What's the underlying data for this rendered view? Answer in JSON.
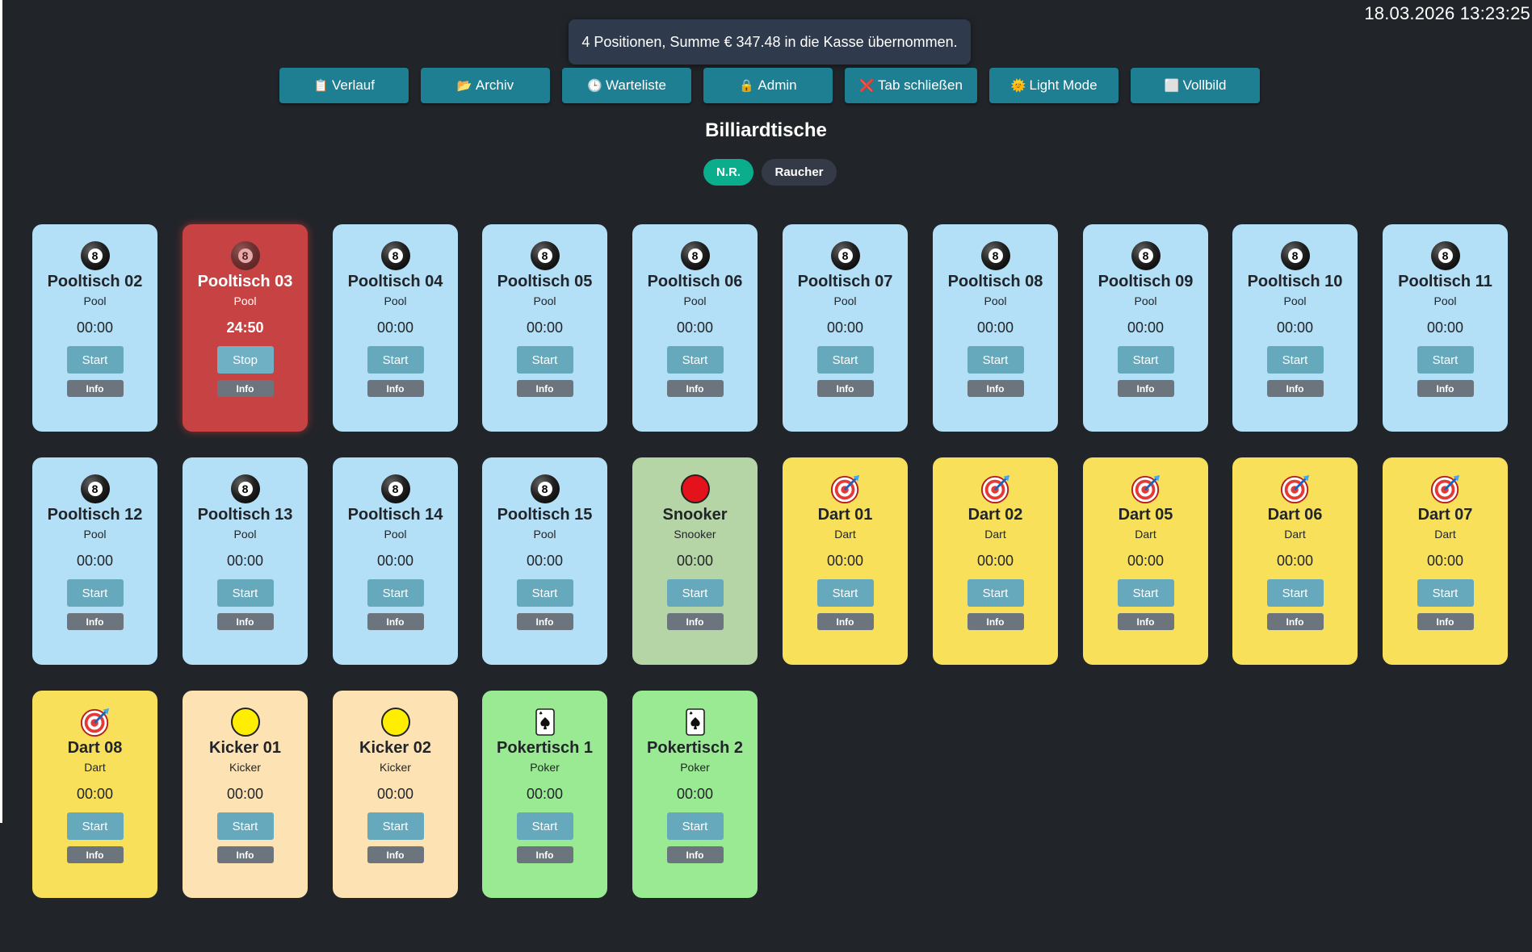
{
  "clock": "18.03.2026 13:23:25",
  "toast": "4 Positionen, Summe € 347.48 in die Kasse übernommen.",
  "toolbar": [
    {
      "icon": "clipboard-icon",
      "glyph": "📋",
      "label": "Verlauf"
    },
    {
      "icon": "folder-icon",
      "glyph": "📂",
      "label": "Archiv"
    },
    {
      "icon": "clock-icon",
      "glyph": "🕒",
      "label": "Warteliste"
    },
    {
      "icon": "lock-icon",
      "glyph": "🔒",
      "label": "Admin"
    },
    {
      "icon": "cross-icon",
      "glyph": "❌",
      "label": "Tab schließen"
    },
    {
      "icon": "sun-icon",
      "glyph": "🌞",
      "label": "Light Mode"
    },
    {
      "icon": "square-icon",
      "glyph": "⬜",
      "label": "Vollbild"
    }
  ],
  "title": "Billiardtische",
  "filters": {
    "nr": "N.R.",
    "raucher": "Raucher"
  },
  "labels": {
    "start": "Start",
    "stop": "Stop",
    "info": "Info"
  },
  "colors": {
    "background": "#212529",
    "toolbar_button": "#1e7f93",
    "pool": "#b3dff7",
    "active": "#c74343",
    "snooker": "#b6d5a6",
    "dart": "#f8e05a",
    "kicker": "#fde2b4",
    "poker": "#9aea93",
    "filter_active": "#0bae8c"
  },
  "tables": [
    {
      "name": "Pooltisch 02",
      "type": "Pool",
      "time": "00:00",
      "icon": "eight-ball-icon",
      "kind": "pool",
      "running": false
    },
    {
      "name": "Pooltisch 03",
      "type": "Pool",
      "time": "24:50",
      "icon": "eight-ball-icon",
      "kind": "pool",
      "running": true
    },
    {
      "name": "Pooltisch 04",
      "type": "Pool",
      "time": "00:00",
      "icon": "eight-ball-icon",
      "kind": "pool",
      "running": false
    },
    {
      "name": "Pooltisch 05",
      "type": "Pool",
      "time": "00:00",
      "icon": "eight-ball-icon",
      "kind": "pool",
      "running": false
    },
    {
      "name": "Pooltisch 06",
      "type": "Pool",
      "time": "00:00",
      "icon": "eight-ball-icon",
      "kind": "pool",
      "running": false
    },
    {
      "name": "Pooltisch 07",
      "type": "Pool",
      "time": "00:00",
      "icon": "eight-ball-icon",
      "kind": "pool",
      "running": false
    },
    {
      "name": "Pooltisch 08",
      "type": "Pool",
      "time": "00:00",
      "icon": "eight-ball-icon",
      "kind": "pool",
      "running": false
    },
    {
      "name": "Pooltisch 09",
      "type": "Pool",
      "time": "00:00",
      "icon": "eight-ball-icon",
      "kind": "pool",
      "running": false
    },
    {
      "name": "Pooltisch 10",
      "type": "Pool",
      "time": "00:00",
      "icon": "eight-ball-icon",
      "kind": "pool",
      "running": false
    },
    {
      "name": "Pooltisch 11",
      "type": "Pool",
      "time": "00:00",
      "icon": "eight-ball-icon",
      "kind": "pool",
      "running": false
    },
    {
      "name": "Pooltisch 12",
      "type": "Pool",
      "time": "00:00",
      "icon": "eight-ball-icon",
      "kind": "pool",
      "running": false
    },
    {
      "name": "Pooltisch 13",
      "type": "Pool",
      "time": "00:00",
      "icon": "eight-ball-icon",
      "kind": "pool",
      "running": false
    },
    {
      "name": "Pooltisch 14",
      "type": "Pool",
      "time": "00:00",
      "icon": "eight-ball-icon",
      "kind": "pool",
      "running": false
    },
    {
      "name": "Pooltisch 15",
      "type": "Pool",
      "time": "00:00",
      "icon": "eight-ball-icon",
      "kind": "pool",
      "running": false
    },
    {
      "name": "Snooker",
      "type": "Snooker",
      "time": "00:00",
      "icon": "red-ball-icon",
      "kind": "snooker",
      "running": false
    },
    {
      "name": "Dart 01",
      "type": "Dart",
      "time": "00:00",
      "icon": "dart-target-icon",
      "kind": "dart",
      "running": false
    },
    {
      "name": "Dart 02",
      "type": "Dart",
      "time": "00:00",
      "icon": "dart-target-icon",
      "kind": "dart",
      "running": false
    },
    {
      "name": "Dart 05",
      "type": "Dart",
      "time": "00:00",
      "icon": "dart-target-icon",
      "kind": "dart",
      "running": false
    },
    {
      "name": "Dart 06",
      "type": "Dart",
      "time": "00:00",
      "icon": "dart-target-icon",
      "kind": "dart",
      "running": false
    },
    {
      "name": "Dart 07",
      "type": "Dart",
      "time": "00:00",
      "icon": "dart-target-icon",
      "kind": "dart",
      "running": false
    },
    {
      "name": "Dart 08",
      "type": "Dart",
      "time": "00:00",
      "icon": "dart-target-icon",
      "kind": "dart",
      "running": false
    },
    {
      "name": "Kicker 01",
      "type": "Kicker",
      "time": "00:00",
      "icon": "yellow-ball-icon",
      "kind": "kicker",
      "running": false
    },
    {
      "name": "Kicker 02",
      "type": "Kicker",
      "time": "00:00",
      "icon": "yellow-ball-icon",
      "kind": "kicker",
      "running": false
    },
    {
      "name": "Pokertisch 1",
      "type": "Poker",
      "time": "00:00",
      "icon": "playing-card-icon",
      "kind": "poker",
      "running": false
    },
    {
      "name": "Pokertisch 2",
      "type": "Poker",
      "time": "00:00",
      "icon": "playing-card-icon",
      "kind": "poker",
      "running": false
    }
  ]
}
